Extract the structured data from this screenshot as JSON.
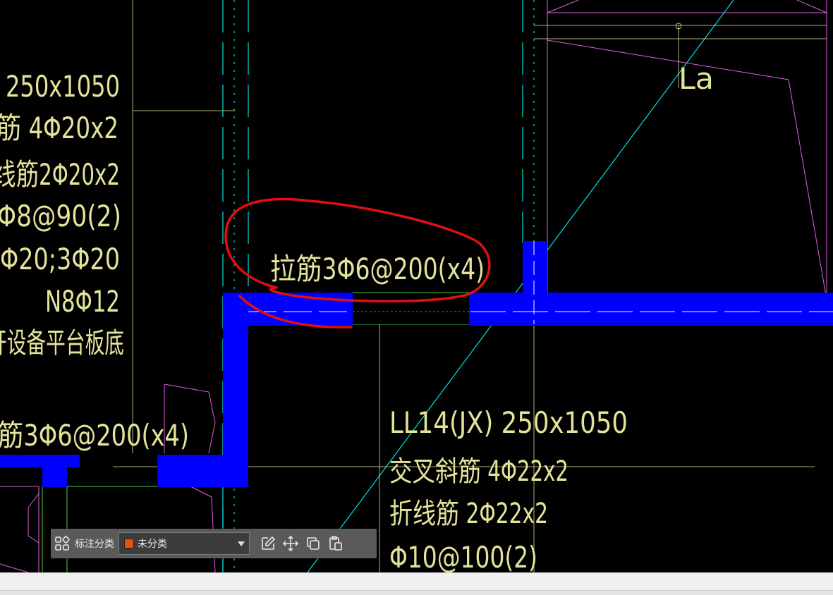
{
  "drawing": {
    "annotations": [
      "250x1050",
      "筋 4Φ20x2",
      "线筋2Φ20x2",
      "Φ8@90(2)",
      "Φ20;3Φ20",
      "N8Φ12",
      "开设备平台板底",
      "筋3Φ6@200(x4)",
      "拉筋3Φ6@200(x4)",
      "La",
      "LL14(JX) 250x1050",
      "交叉斜筋 4Φ22x2",
      "折线筋 2Φ22x2",
      "Φ10@100(2)"
    ]
  },
  "toolbar": {
    "label": "标注分类",
    "select_value": "未分类",
    "swatch_color": "#e8520e",
    "icons": [
      "grid-icon",
      "edit-icon",
      "move-icon",
      "copy-icon",
      "paste-icon"
    ]
  },
  "colors": {
    "background": "#000000",
    "wall_fill": "#0000ff",
    "text": "#e3e39a",
    "line_cyan": "#00e5e5",
    "line_magenta": "#e060e0",
    "line_green": "#40d040",
    "line_yellow": "#e3e39a",
    "highlight_circle": "#e01010"
  }
}
